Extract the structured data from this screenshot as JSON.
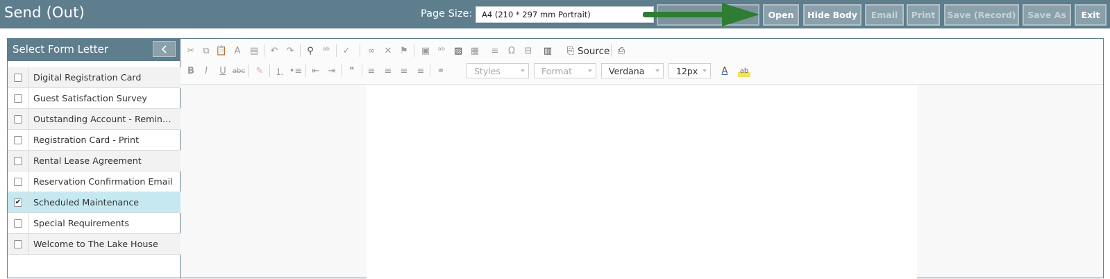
{
  "header": {
    "title": "Send (Out)",
    "page_size_label": "Page Size:",
    "page_size_value": "A4 (210 * 297 mm Portrait)",
    "buttons": {
      "open": "Open",
      "hide_body": "Hide Body",
      "email": "Email",
      "print": "Print",
      "save_record": "Save (Record)",
      "save_as": "Save As",
      "exit": "Exit"
    }
  },
  "panel": {
    "title": "Select Form Letter",
    "items": [
      {
        "label": "Digital Registration Card",
        "checked": false
      },
      {
        "label": "Guest Satisfaction Survey",
        "checked": false
      },
      {
        "label": "Outstanding Account - Reminder",
        "checked": false
      },
      {
        "label": "Registration Card - Print",
        "checked": false
      },
      {
        "label": "Rental Lease Agreement",
        "checked": false
      },
      {
        "label": "Reservation Confirmation Email",
        "checked": false
      },
      {
        "label": "Scheduled Maintenance",
        "checked": true
      },
      {
        "label": "Special Requirements",
        "checked": false
      },
      {
        "label": "Welcome to The Lake House",
        "checked": false
      }
    ]
  },
  "editor": {
    "source_label": "Source",
    "styles_placeholder": "Styles",
    "format_placeholder": "Format",
    "font_value": "Verdana",
    "size_value": "12px"
  },
  "colors": {
    "header_bg": "#5e7d8d",
    "selected_row": "#c6e9f1",
    "annotation_arrow": "#2e7d32"
  }
}
